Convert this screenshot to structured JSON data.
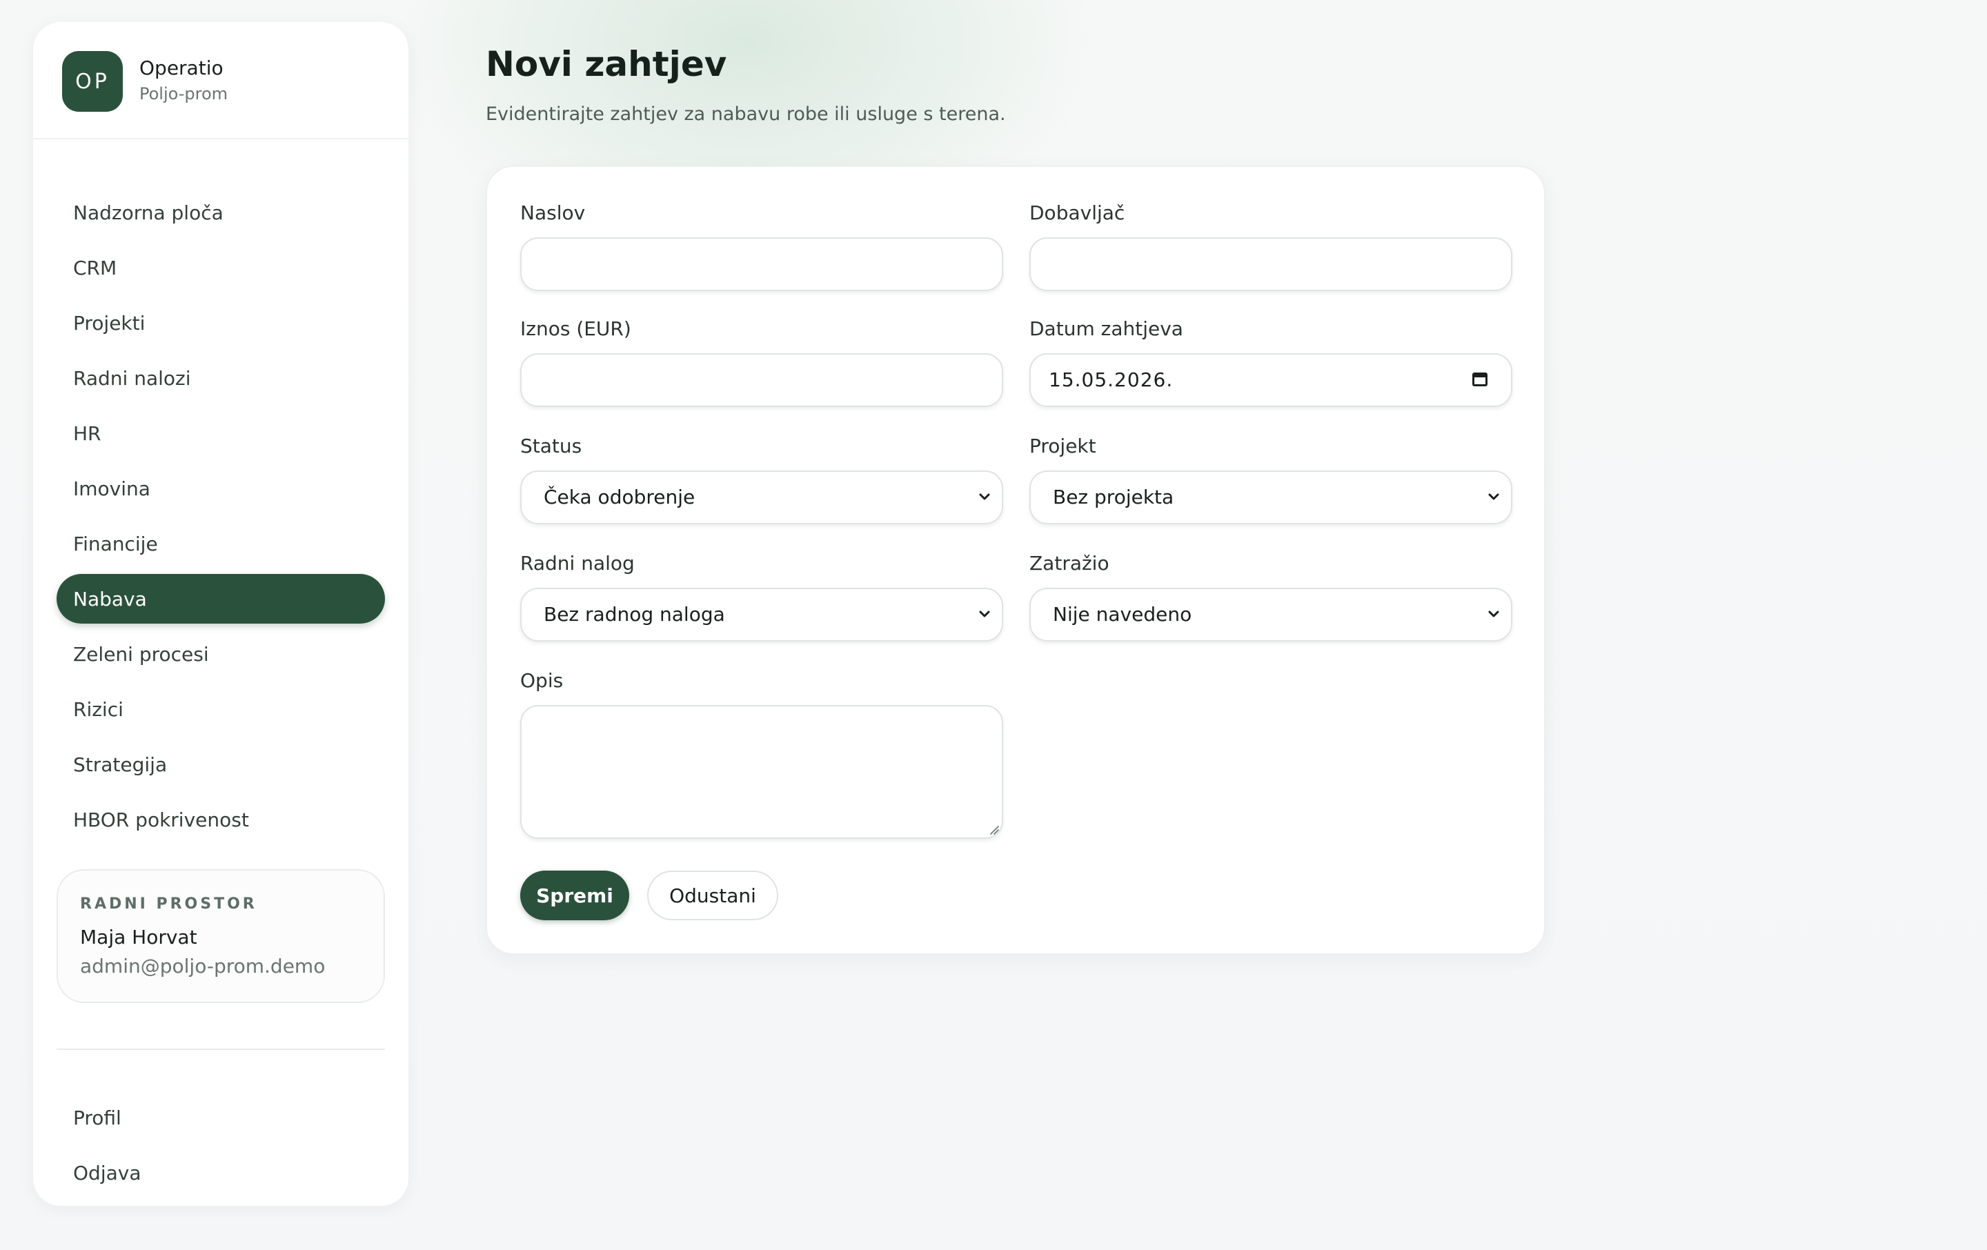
{
  "brand": {
    "initials": "OP",
    "name": "Operatio",
    "subtitle": "Poljo-prom"
  },
  "nav": {
    "items": [
      {
        "label": "Nadzorna ploča"
      },
      {
        "label": "CRM"
      },
      {
        "label": "Projekti"
      },
      {
        "label": "Radni nalozi"
      },
      {
        "label": "HR"
      },
      {
        "label": "Imovina"
      },
      {
        "label": "Financije"
      },
      {
        "label": "Nabava",
        "active": true
      },
      {
        "label": "Zeleni procesi"
      },
      {
        "label": "Rizici"
      },
      {
        "label": "Strategija"
      },
      {
        "label": "HBOR pokrivenost"
      }
    ]
  },
  "workspace": {
    "label": "RADNI PROSTOR",
    "user": "Maja Horvat",
    "email": "admin@poljo-prom.demo"
  },
  "footer_nav": {
    "profile": "Profil",
    "logout": "Odjava"
  },
  "page": {
    "title": "Novi zahtjev",
    "subtitle": "Evidentirajte zahtjev za nabavu robe ili usluge s terena."
  },
  "form": {
    "naslov": {
      "label": "Naslov",
      "value": ""
    },
    "dobavljac": {
      "label": "Dobavljač",
      "value": ""
    },
    "iznos": {
      "label": "Iznos (EUR)",
      "value": ""
    },
    "datum": {
      "label": "Datum zahtjeva",
      "value": "15.05.2026."
    },
    "status": {
      "label": "Status",
      "value": "Čeka odobrenje"
    },
    "projekt": {
      "label": "Projekt",
      "value": "Bez projekta"
    },
    "radni_nalog": {
      "label": "Radni nalog",
      "value": "Bez radnog naloga"
    },
    "zatrazio": {
      "label": "Zatražio",
      "value": "Nije navedeno"
    },
    "opis": {
      "label": "Opis",
      "value": ""
    },
    "save_label": "Spremi",
    "cancel_label": "Odustani"
  },
  "colors": {
    "accent": "#2a513c",
    "background": "#f5f6f8",
    "card": "#ffffff"
  }
}
